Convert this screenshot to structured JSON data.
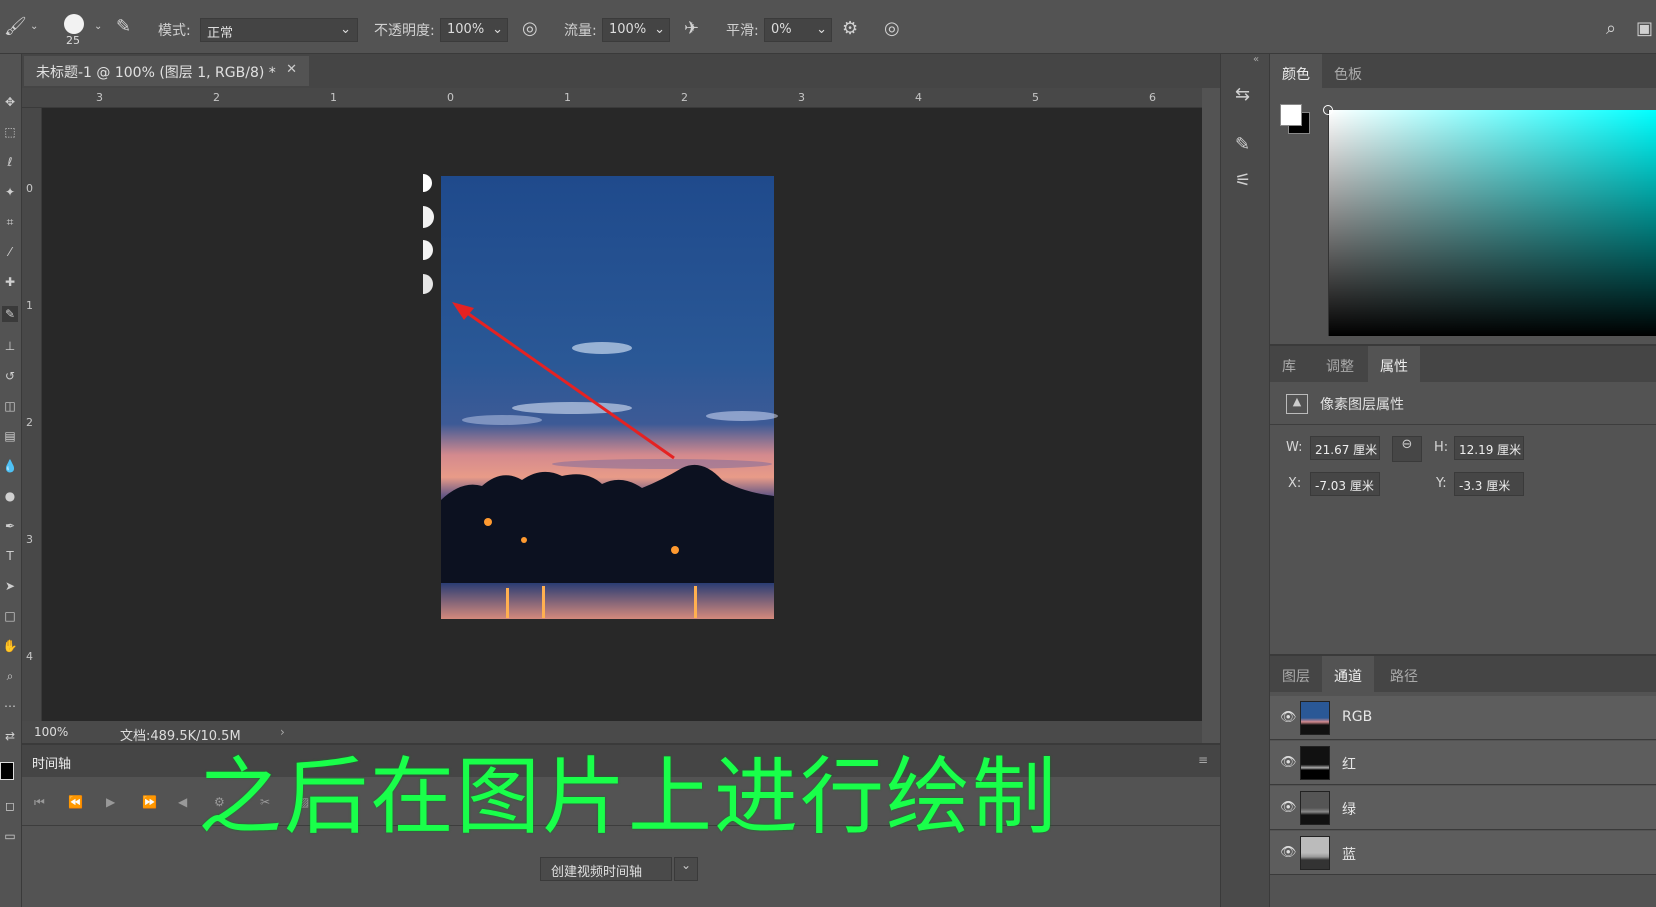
{
  "options_bar": {
    "brush_size": "25",
    "mode_label": "模式:",
    "mode_value": "正常",
    "opacity_label": "不透明度:",
    "opacity_value": "100%",
    "flow_label": "流量:",
    "flow_value": "100%",
    "smoothing_label": "平滑:",
    "smoothing_value": "0%"
  },
  "document": {
    "tab_title": "未标题-1 @ 100% (图层 1, RGB/8) *",
    "zoom": "100%",
    "doc_info": "文档:489.5K/10.5M"
  },
  "rulers": {
    "horizontal": [
      "3",
      "2",
      "1",
      "0",
      "1",
      "2",
      "3",
      "4",
      "5",
      "6"
    ],
    "vertical": [
      "0",
      "1",
      "2",
      "3",
      "4"
    ]
  },
  "timeline": {
    "tab": "时间轴",
    "create_button": "创建视频时间轴"
  },
  "color_panel": {
    "tabs": [
      "颜色",
      "色板"
    ],
    "active_tab": "颜色",
    "spectrum_hue": "#00ffff"
  },
  "properties_panel": {
    "tabs": [
      "库",
      "调整",
      "属性"
    ],
    "active_tab": "属性",
    "title": "像素图层属性",
    "w_label": "W:",
    "w_value": "21.67 厘米",
    "h_label": "H:",
    "h_value": "12.19 厘米",
    "x_label": "X:",
    "x_value": "-7.03 厘米",
    "y_label": "Y:",
    "y_value": "-3.3 厘米"
  },
  "channels_panel": {
    "tabs": [
      "图层",
      "通道",
      "路径"
    ],
    "active_tab": "通道",
    "channels": [
      {
        "name": "RGB"
      },
      {
        "name": "红"
      },
      {
        "name": "绿"
      },
      {
        "name": "蓝"
      }
    ]
  },
  "subtitle": "之后在图片上进行绘制",
  "colors": {
    "annotation_arrow": "#e52222",
    "subtitle_text": "#19ff4a"
  }
}
